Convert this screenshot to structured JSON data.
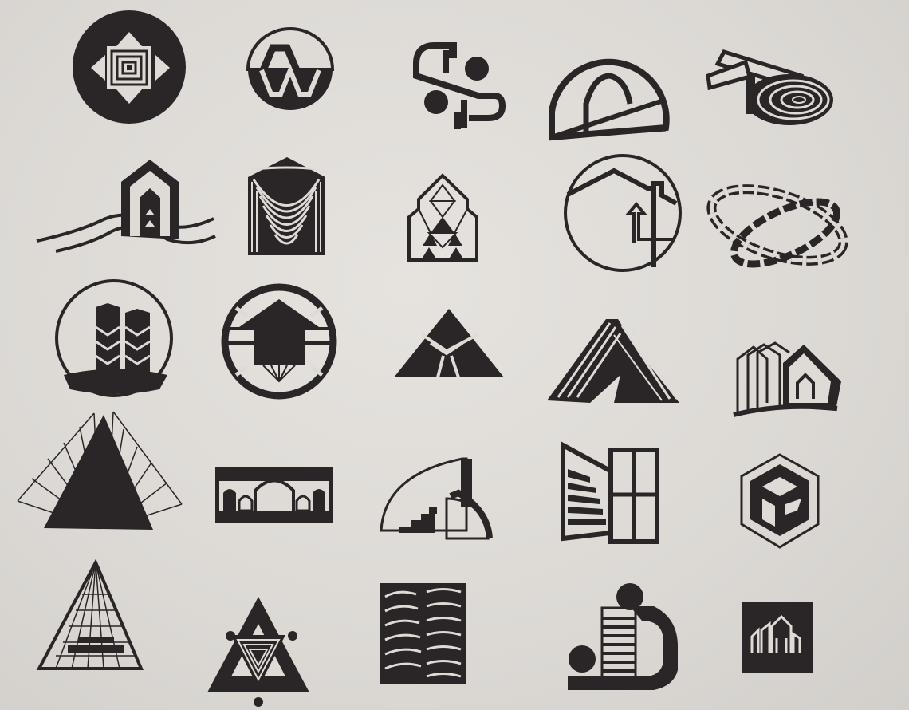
{
  "sheet": {
    "paper_color": "#dedbd7",
    "ink_color": "#2a2526",
    "logos": [
      {
        "id": "arrows-square-circle"
      },
      {
        "id": "half-circle-letter"
      },
      {
        "id": "s-shape-dots"
      },
      {
        "id": "arch-half-circle"
      },
      {
        "id": "spiral-roll"
      },
      {
        "id": "house-on-waves"
      },
      {
        "id": "house-stripes"
      },
      {
        "id": "triangle-grid-house"
      },
      {
        "id": "house-arrow-circle"
      },
      {
        "id": "chain-rings"
      },
      {
        "id": "twin-towers-circle"
      },
      {
        "id": "roof-in-circle"
      },
      {
        "id": "triangle-y-road"
      },
      {
        "id": "a-frame-stripes"
      },
      {
        "id": "stacked-houses"
      },
      {
        "id": "fan-pyramid"
      },
      {
        "id": "bridge-arches"
      },
      {
        "id": "quarter-circle-steps"
      },
      {
        "id": "window-building"
      },
      {
        "id": "hexagon-cube"
      },
      {
        "id": "wire-pyramid"
      },
      {
        "id": "nested-triangles"
      },
      {
        "id": "curved-blinds"
      },
      {
        "id": "coil-hook"
      },
      {
        "id": "square-buildings"
      }
    ]
  }
}
